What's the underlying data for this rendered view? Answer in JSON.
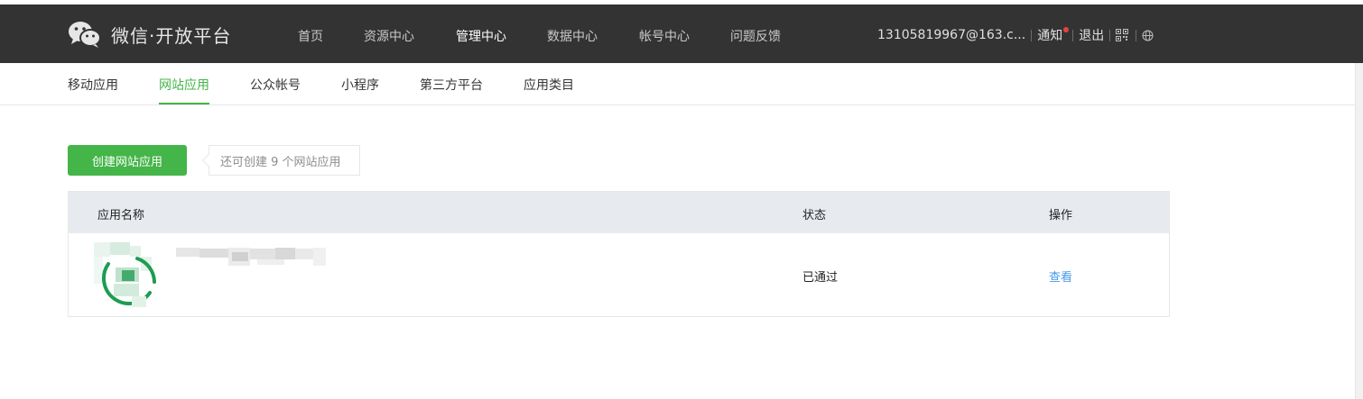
{
  "header": {
    "logo_text": "微信·开放平台",
    "nav": [
      {
        "label": "首页"
      },
      {
        "label": "资源中心"
      },
      {
        "label": "管理中心"
      },
      {
        "label": "数据中心"
      },
      {
        "label": "帐号中心"
      },
      {
        "label": "问题反馈"
      }
    ],
    "active_nav": "管理中心",
    "account": "13105819967@163.c...",
    "notice_label": "通知",
    "logout_label": "退出",
    "icons": [
      "wechat-logo-icon",
      "qr-code-icon",
      "globe-icon"
    ]
  },
  "subnav": {
    "items": [
      {
        "label": "移动应用"
      },
      {
        "label": "网站应用"
      },
      {
        "label": "公众帐号"
      },
      {
        "label": "小程序"
      },
      {
        "label": "第三方平台"
      },
      {
        "label": "应用类目"
      }
    ],
    "active": "网站应用"
  },
  "toolbar": {
    "create_label": "创建网站应用",
    "remaining_tip": "还可创建 9 个网站应用"
  },
  "table": {
    "columns": [
      "应用名称",
      "状态",
      "操作"
    ],
    "rows": [
      {
        "status": "已通过",
        "action": "查看"
      }
    ]
  },
  "colors": {
    "header_bg": "#333333",
    "accent_green": "#44b549",
    "link_blue": "#459ae9",
    "table_head_bg": "#e7ebef",
    "notice_dot": "#e64340"
  }
}
